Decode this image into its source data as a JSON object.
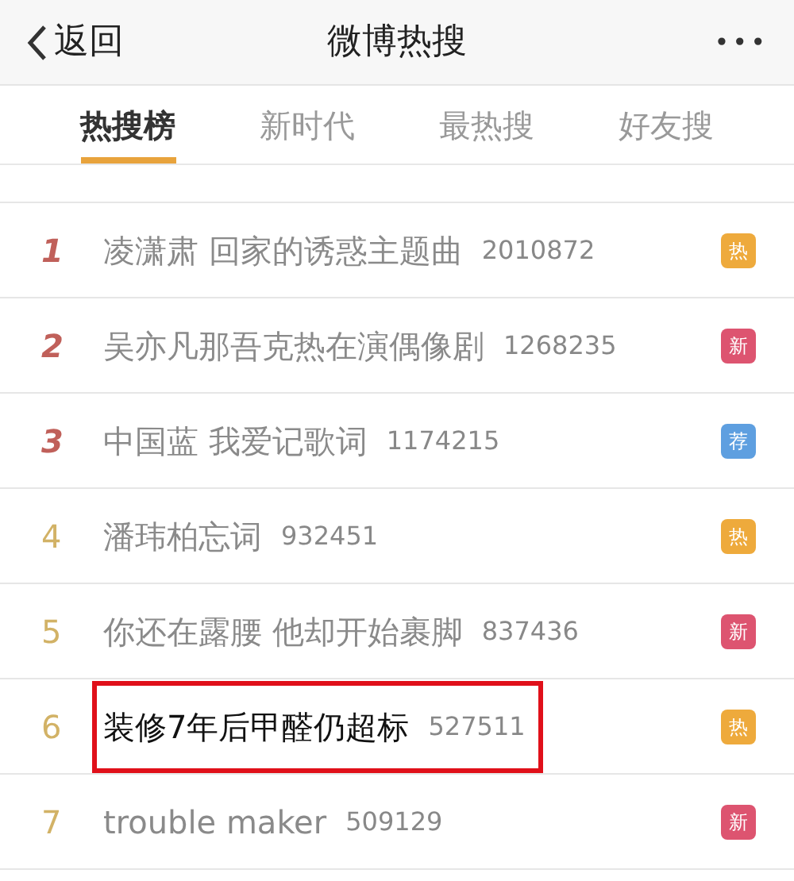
{
  "header": {
    "back_label": "返回",
    "title": "微博热搜",
    "more": "•••"
  },
  "tabs": [
    {
      "label": "热搜榜",
      "selected": true
    },
    {
      "label": "新时代",
      "selected": false
    },
    {
      "label": "最热搜",
      "selected": false
    },
    {
      "label": "好友搜",
      "selected": false
    }
  ],
  "rows": [
    {
      "rank": "1",
      "title": "凌潇肃 回家的诱惑主题曲",
      "count": "2010872",
      "badge": "热",
      "color": "#eeaa3c",
      "top_rank": true,
      "highlighted": false
    },
    {
      "rank": "2",
      "title": "吴亦凡那吾克热在演偶像剧",
      "count": "1268235",
      "badge": "新",
      "color": "#dd5470",
      "top_rank": true,
      "highlighted": false
    },
    {
      "rank": "3",
      "title": "中国蓝 我爱记歌词",
      "count": "1174215",
      "badge": "荐",
      "color": "#5e9fe0",
      "top_rank": true,
      "highlighted": false
    },
    {
      "rank": "4",
      "title": "潘玮柏忘词",
      "count": "932451",
      "badge": "热",
      "color": "#eeaa3c",
      "top_rank": false,
      "highlighted": false
    },
    {
      "rank": "5",
      "title": "你还在露腰 他却开始裹脚",
      "count": "837436",
      "badge": "新",
      "color": "#dd5470",
      "top_rank": false,
      "highlighted": false
    },
    {
      "rank": "6",
      "title": "装修7年后甲醛仍超标",
      "count": "527511",
      "badge": "热",
      "color": "#eeaa3c",
      "top_rank": false,
      "highlighted": true
    },
    {
      "rank": "7",
      "title": "trouble maker",
      "count": "509129",
      "badge": "新",
      "color": "#dd5470",
      "top_rank": false,
      "highlighted": false
    }
  ]
}
